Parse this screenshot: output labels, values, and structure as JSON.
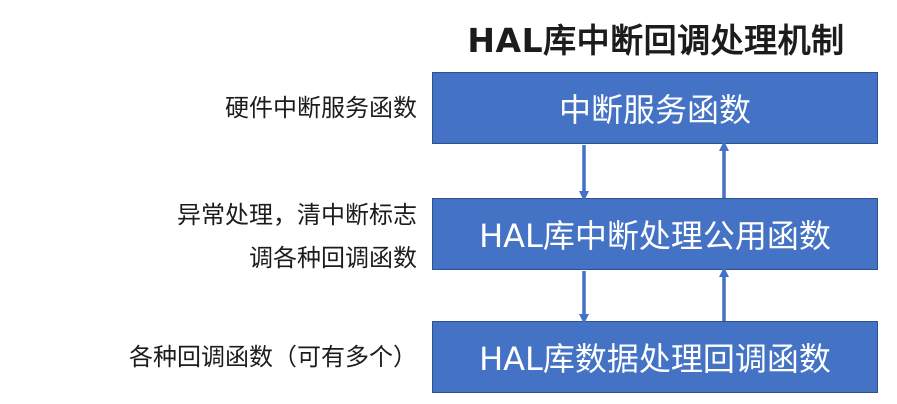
{
  "title": "HAL库中断回调处理机制",
  "boxes": {
    "isr": "中断服务函数",
    "common": "HAL库中断处理公用函数",
    "callback": "HAL库数据处理回调函数"
  },
  "labels": {
    "isr": "硬件中断服务函数",
    "common_line1": "异常处理，清中断标志",
    "common_line2": "调各种回调函数",
    "callback": "各种回调函数（可有多个）"
  },
  "colors": {
    "box_fill": "#4472c4",
    "box_border": "#2f528f",
    "arrow": "#4472c4"
  }
}
